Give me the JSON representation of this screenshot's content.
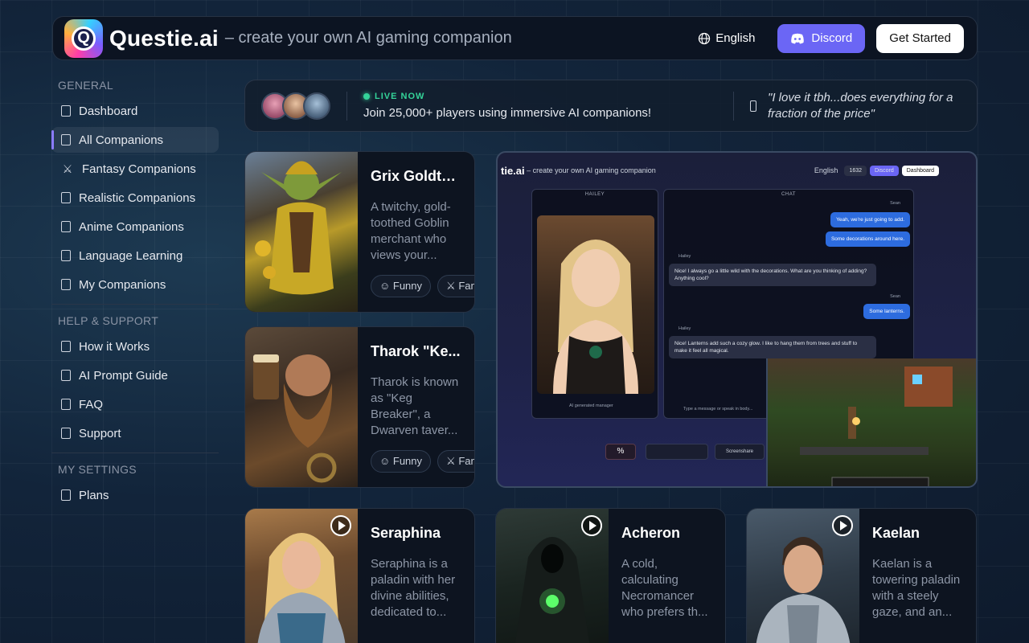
{
  "header": {
    "brand": "Questie.ai",
    "tagline": "– create your own AI gaming companion",
    "language": "English",
    "discord": "Discord",
    "get_started": "Get Started"
  },
  "sidebar": {
    "general_title": "GENERAL",
    "general": [
      {
        "label": "Dashboard"
      },
      {
        "label": "All Companions"
      },
      {
        "label": "Fantasy Companions"
      },
      {
        "label": "Realistic Companions"
      },
      {
        "label": "Anime Companions"
      },
      {
        "label": "Language Learning"
      },
      {
        "label": "My Companions"
      }
    ],
    "help_title": "HELP & SUPPORT",
    "help": [
      {
        "label": "How it Works"
      },
      {
        "label": "AI Prompt Guide"
      },
      {
        "label": "FAQ"
      },
      {
        "label": "Support"
      }
    ],
    "settings_title": "MY SETTINGS",
    "settings": [
      {
        "label": "Plans"
      }
    ]
  },
  "banner": {
    "live": "LIVE NOW",
    "message": "Join 25,000+ players using immersive AI companions!",
    "quote": "\"I love it tbh...does everything for a fraction of the price\""
  },
  "cards": [
    {
      "name": "Grix Goldto...",
      "desc": "A twitchy, gold-toothed Goblin merchant who views your...",
      "tags": [
        "Funny",
        "Fan"
      ]
    },
    {
      "name": "Tharok \"Ke...",
      "desc": "Tharok is known as \"Keg Breaker\", a Dwarven taver...",
      "tags": [
        "Funny",
        "Fan"
      ]
    },
    {
      "name": "Seraphina",
      "desc": "Seraphina is a paladin with her divine abilities, dedicated to..."
    },
    {
      "name": "Acheron",
      "desc": "A cold, calculating Necromancer who prefers th..."
    },
    {
      "name": "Kaelan",
      "desc": "Kaelan is a towering paladin with a steely gaze, and an..."
    }
  ],
  "preview": {
    "brand": "tie.ai",
    "tagline": "– create your own AI gaming companion",
    "lang": "English",
    "count": "1632",
    "discord": "Discord",
    "dashboard": "Dashboard",
    "hailey_label": "HAILEY",
    "chat_label": "CHAT",
    "ai_note": "AI generated manager",
    "input_placeholder": "Type a message or speak in body...",
    "screenshare": "Screenshare",
    "msgs": [
      {
        "who": "Sean",
        "text": "Yeah, we're just going to add."
      },
      {
        "who": "",
        "text": "Some decorations around here."
      },
      {
        "who": "Hailey",
        "text": "Nice! I always go a little wild with the decorations. What are you thinking of adding? Anything cool?"
      },
      {
        "who": "Sean",
        "text": "Some lanterns."
      },
      {
        "who": "Hailey",
        "text": "Nice! Lanterns add such a cozy glow. I like to hang them from trees and stuff to make it feel all magical."
      }
    ]
  }
}
